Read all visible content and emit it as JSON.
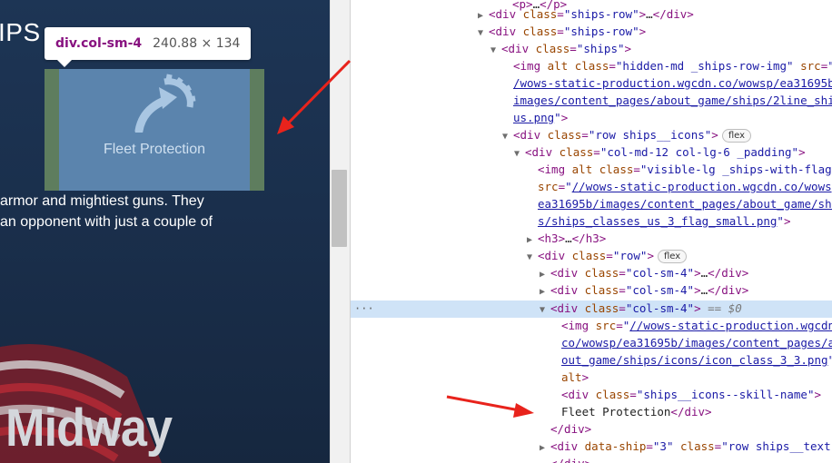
{
  "page": {
    "heading_partial": "IPS",
    "paragraph_lines": [
      " armor and mightiest guns. They",
      "an opponent with just a couple of"
    ],
    "ship_name_partial": "Midway",
    "highlighted_label": "Fleet Protection"
  },
  "tooltip": {
    "tag": "div.col-sm-4",
    "dimensions": "240.88 × 134"
  },
  "devtools": {
    "lines": [
      {
        "caret": "",
        "html": "<span class='tg'>&lt;p&gt;</span>…<span class='tg'>&lt;/p&gt;</span>",
        "plain": "<p>…</p>"
      },
      {
        "caret": "▶",
        "plain": "<div class=\"ships-row\">…</div>"
      },
      {
        "caret": "▼",
        "plain": "<div class=\"ships-row\">"
      },
      {
        "caret": "▼",
        "plain": "<div class=\"ships\">"
      },
      {
        "caret": "",
        "plain": "<img alt class=\"hidden-md _ships-row-img\" src=\"/"
      },
      {
        "caret": "",
        "plain": "/wows-static-production.wgcdn.co/wowsp/ea31695b/"
      },
      {
        "caret": "",
        "plain": "images/content_pages/about_game/ships/2line_ships_"
      },
      {
        "caret": "",
        "plain": "us.png\">"
      },
      {
        "caret": "▼",
        "plain": "<div class=\"row ships__icons\">",
        "badge": "flex"
      },
      {
        "caret": "▼",
        "plain": "<div class=\"col-md-12 col-lg-6 _padding\">"
      },
      {
        "caret": "",
        "plain": "<img alt class=\"visible-lg _ships-with-flag\""
      },
      {
        "caret": "",
        "plain": "src=\"//wows-static-production.wgcdn.co/wowsp/"
      },
      {
        "caret": "",
        "plain": "ea31695b/images/content_pages/about_game/shi"
      },
      {
        "caret": "",
        "plain": "s/ships_classes_us_3_flag_small.png\">"
      },
      {
        "caret": "▶",
        "plain": "<h3>…</h3>"
      },
      {
        "caret": "▼",
        "plain": "<div class=\"row\">",
        "badge": "flex"
      },
      {
        "caret": "▶",
        "plain": "<div class=\"col-sm-4\">…</div>"
      },
      {
        "caret": "▶",
        "plain": "<div class=\"col-sm-4\">…</div>"
      },
      {
        "caret": "▼",
        "plain": "<div class=\"col-sm-4\"> == $0"
      },
      {
        "caret": "",
        "plain": "<img src=\"//wows-static-production.wgcdn."
      },
      {
        "caret": "",
        "plain": "co/wowsp/ea31695b/images/content_pages/ab"
      },
      {
        "caret": "",
        "plain": "out_game/ships/icons/icon_class_3_3.png\""
      },
      {
        "caret": "",
        "plain": "alt>"
      },
      {
        "caret": "",
        "plain": "<div class=\"ships__icons--skill-name\">"
      },
      {
        "caret": "",
        "plain": "Fleet Protection</div>"
      },
      {
        "caret": "",
        "plain": "</div>"
      },
      {
        "caret": "▶",
        "plain": "<div data-ship=\"3\" class=\"row ships__text\">"
      },
      {
        "caret": "",
        "plain": "</div>"
      }
    ],
    "badge_flex": "flex",
    "selected_marker": "== $0",
    "dots_label": "···"
  },
  "colors": {
    "annotation_arrow": "#e8231c",
    "highlight_content": "#5b84ad",
    "highlight_padding": "#5e7d5e",
    "selected_row": "#cfe3f7",
    "tag": "#881280",
    "attr_name": "#994500",
    "attr_value": "#1a1aa6"
  }
}
